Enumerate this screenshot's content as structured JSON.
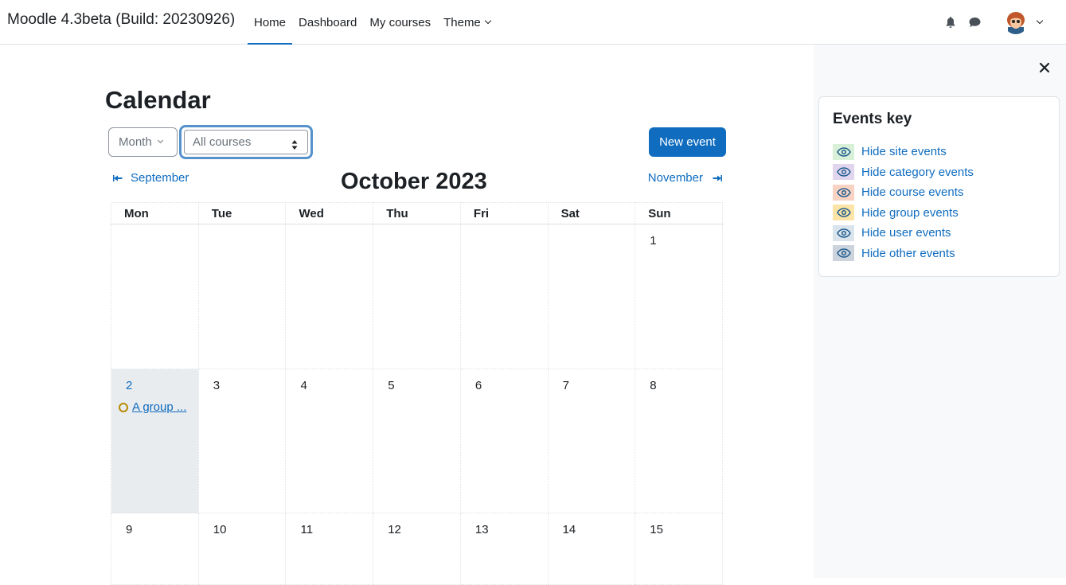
{
  "navbar": {
    "brand": "Moodle 4.3beta (Build: 20230926)",
    "items": [
      {
        "label": "Home"
      },
      {
        "label": "Dashboard"
      },
      {
        "label": "My courses"
      },
      {
        "label": "Theme"
      }
    ]
  },
  "page": {
    "title": "Calendar",
    "view_select": "Month",
    "course_select": "All courses",
    "new_event": "New event",
    "prev_month": "September",
    "next_month": "November",
    "month_title": "October 2023"
  },
  "calendar": {
    "weekdays": [
      "Mon",
      "Tue",
      "Wed",
      "Thu",
      "Fri",
      "Sat",
      "Sun"
    ],
    "weeks": [
      [
        "",
        "",
        "",
        "",
        "",
        "",
        "1"
      ],
      [
        "2",
        "3",
        "4",
        "5",
        "6",
        "7",
        "8"
      ],
      [
        "9",
        "10",
        "11",
        "12",
        "13",
        "14",
        "15"
      ]
    ],
    "event": {
      "label": "A group ...",
      "color": "#b88a00"
    }
  },
  "events_key": {
    "title": "Events key",
    "items": [
      {
        "label": "Hide site events",
        "color": "#d8f0d8"
      },
      {
        "label": "Hide category events",
        "color": "#e2d6ef"
      },
      {
        "label": "Hide course events",
        "color": "#f8d3c3"
      },
      {
        "label": "Hide group events",
        "color": "#fbe4a6"
      },
      {
        "label": "Hide user events",
        "color": "#d9e4ec"
      },
      {
        "label": "Hide other events",
        "color": "#cbd3dc"
      }
    ]
  }
}
